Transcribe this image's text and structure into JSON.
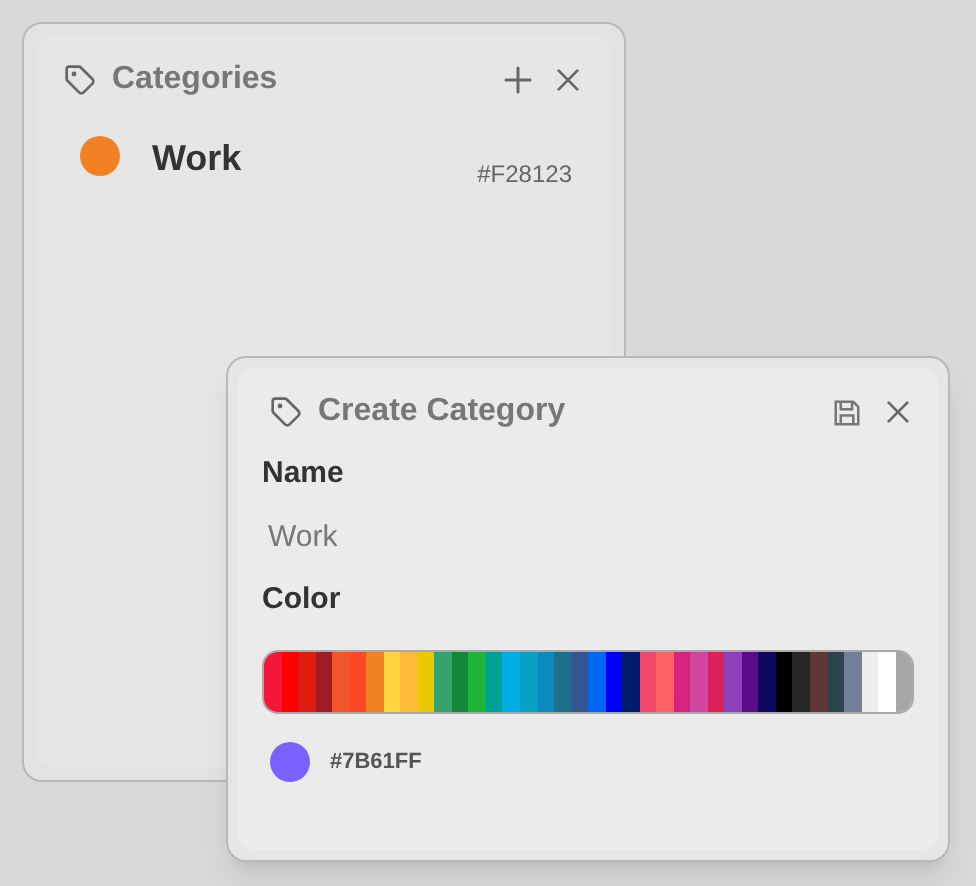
{
  "categories_panel": {
    "title": "Categories",
    "items": [
      {
        "name": "Work",
        "code": "#F28123",
        "color": "#f28123"
      }
    ]
  },
  "create_dialog": {
    "title": "Create Category",
    "name_label": "Name",
    "name_field": {
      "placeholder": "Work"
    },
    "color_label": "Color",
    "palette": [
      {
        "color": "#f5173a"
      },
      {
        "color": "#ff0000"
      },
      {
        "color": "#e01b10"
      },
      {
        "color": "#a21a24"
      },
      {
        "color": "#f0562a"
      },
      {
        "color": "#ff4724"
      },
      {
        "color": "#f28123"
      },
      {
        "color": "#ffd43f"
      },
      {
        "color": "#fcba35"
      },
      {
        "color": "#ebc900"
      },
      {
        "color": "#36a36d"
      },
      {
        "color": "#138838"
      },
      {
        "color": "#1eb53a"
      },
      {
        "color": "#00a296"
      },
      {
        "color": "#00aee3"
      },
      {
        "color": "#079fc3"
      },
      {
        "color": "#0a8abf"
      },
      {
        "color": "#1d6f8c"
      },
      {
        "color": "#335691"
      },
      {
        "color": "#0066f5"
      },
      {
        "color": "#0000ff"
      },
      {
        "color": "#001a6e"
      },
      {
        "color": "#f0476a"
      },
      {
        "color": "#ff6262"
      },
      {
        "color": "#d8227f"
      },
      {
        "color": "#d2469f"
      },
      {
        "color": "#db1f5b"
      },
      {
        "color": "#8e40bc"
      },
      {
        "color": "#5e0b89"
      },
      {
        "color": "#0d0560"
      },
      {
        "color": "#000000"
      },
      {
        "color": "#262626"
      },
      {
        "color": "#61353a"
      },
      {
        "color": "#2a464c"
      },
      {
        "color": "#718096"
      },
      {
        "color": "#eeeeee"
      },
      {
        "color": "#ffffff"
      },
      {
        "color": "#a6a6a6"
      }
    ],
    "chosen": {
      "code": "#7B61FF",
      "color": "#7b61ff"
    }
  }
}
